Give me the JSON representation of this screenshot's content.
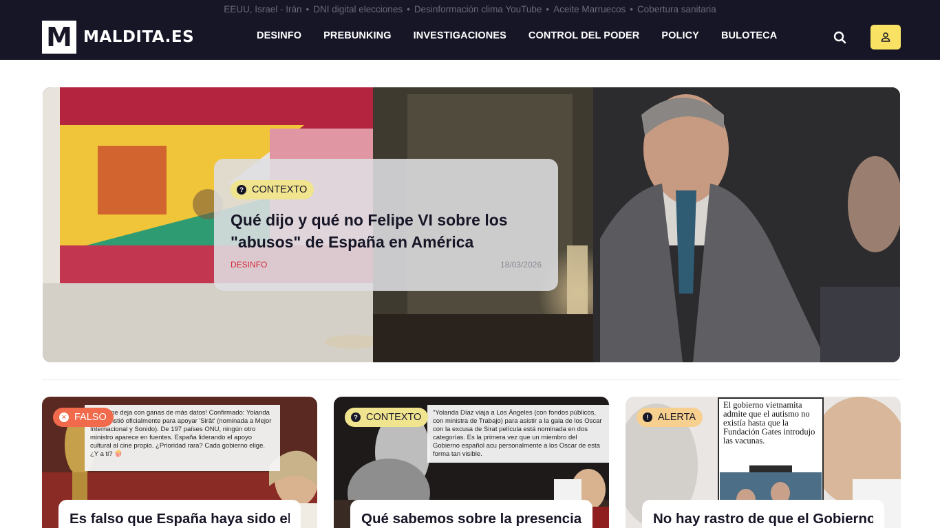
{
  "trending": [
    "EEUU, Israel - Irán",
    "DNI digital elecciones",
    "Desinformación clima YouTube",
    "Aceite Marruecos",
    "Cobertura sanitaria"
  ],
  "logo": {
    "mark": "M",
    "text": "MALDITA.ES"
  },
  "nav": [
    "DESINFO",
    "PREBUNKING",
    "INVESTIGACIONES",
    "CONTROL DEL PODER",
    "POLICY",
    "BULOTECA"
  ],
  "icons": {
    "search": "search-icon",
    "user": "user-icon"
  },
  "colors": {
    "header_bg": "#171627",
    "accent_yellow": "#f8e163",
    "contexto": "#f1e48f",
    "falso": "#f06a4b",
    "alerta": "#f7cf8f",
    "category_red": "#d4283b"
  },
  "hero": {
    "badge": "CONTEXTO",
    "title": "Qué dijo y qué no Felipe VI sobre los \"abusos\" de España en América",
    "category": "DESINFO",
    "date": "18/03/2026"
  },
  "cards": [
    {
      "badge": "FALSO",
      "title": "Es falso que España haya sido el",
      "image_text": "¡Pues me deja con ganas de más datos! Confirmado: Yolanda Díaz asistió oficialmente para apoyar 'Sirât' (nominada a Mejor Internacional y Sonido). De 197 países ONU, ningún otro ministro aparece en fuentes. España liderando el apoyo cultural al cine propio. ¿Prioridad rara? Cada gobierno elige. ¿Y a ti? 🍿"
    },
    {
      "badge": "CONTEXTO",
      "title": "Qué sabemos sobre la presencia",
      "image_text": "\"Yolanda Díaz viaja a Los Ángeles (con fondos públicos, con ministra de Trabajo) para asistir a la gala de los Oscar con la excusa de Sirat película está nominada en dos categorías. Es la primera vez que un miembro del Gobierno español acu personalmente a los Oscar de esta forma tan visible."
    },
    {
      "badge": "ALERTA",
      "title": "No hay rastro de que el Gobierno",
      "image_text": "El gobierno vietnamita admite que el autismo no existía hasta que la Fundación Gates introdujo las vacunas."
    }
  ]
}
